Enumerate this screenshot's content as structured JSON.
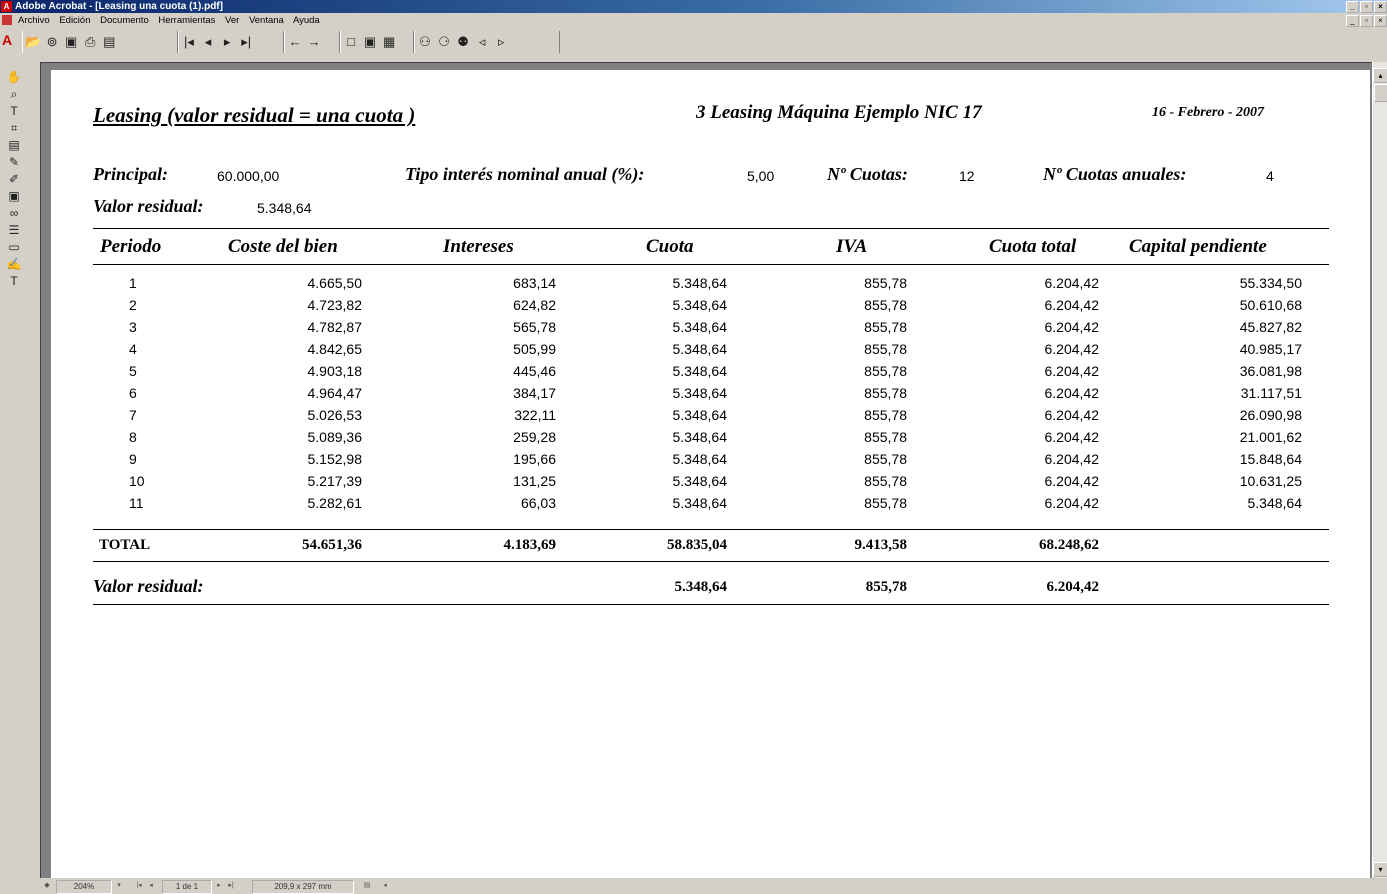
{
  "window": {
    "title": "Adobe Acrobat - [Leasing una cuota (1).pdf]",
    "min": "_",
    "max": "▫",
    "close": "×"
  },
  "menu": [
    "Archivo",
    "Edición",
    "Documento",
    "Herramientas",
    "Ver",
    "Ventana",
    "Ayuda"
  ],
  "status": {
    "zoom": "204%",
    "page": "1 de 1",
    "size": "209,9 x 297 mm"
  },
  "doc": {
    "title": "Leasing  (valor residual  = una cuota )",
    "subtitle": "3 Leasing Máquina Ejemplo NIC 17",
    "date": "16 - Febrero - 2007",
    "principal_label": "Principal:",
    "principal_value": "60.000,00",
    "rate_label": "Tipo interés nominal anual (%):",
    "rate_value": "5,00",
    "cuotas_label": "Nº Cuotas:",
    "cuotas_value": "12",
    "cuotas_anuales_label": "Nº Cuotas anuales:",
    "cuotas_anuales_value": "4",
    "residual_label": "Valor residual:",
    "residual_value": "5.348,64",
    "columns": [
      "Periodo",
      "Coste del bien",
      "Intereses",
      "Cuota",
      "IVA",
      "Cuota total",
      "Capital pendiente"
    ],
    "rows": [
      [
        "1",
        "4.665,50",
        "683,14",
        "5.348,64",
        "855,78",
        "6.204,42",
        "55.334,50"
      ],
      [
        "2",
        "4.723,82",
        "624,82",
        "5.348,64",
        "855,78",
        "6.204,42",
        "50.610,68"
      ],
      [
        "3",
        "4.782,87",
        "565,78",
        "5.348,64",
        "855,78",
        "6.204,42",
        "45.827,82"
      ],
      [
        "4",
        "4.842,65",
        "505,99",
        "5.348,64",
        "855,78",
        "6.204,42",
        "40.985,17"
      ],
      [
        "5",
        "4.903,18",
        "445,46",
        "5.348,64",
        "855,78",
        "6.204,42",
        "36.081,98"
      ],
      [
        "6",
        "4.964,47",
        "384,17",
        "5.348,64",
        "855,78",
        "6.204,42",
        "31.117,51"
      ],
      [
        "7",
        "5.026,53",
        "322,11",
        "5.348,64",
        "855,78",
        "6.204,42",
        "26.090,98"
      ],
      [
        "8",
        "5.089,36",
        "259,28",
        "5.348,64",
        "855,78",
        "6.204,42",
        "21.001,62"
      ],
      [
        "9",
        "5.152,98",
        "195,66",
        "5.348,64",
        "855,78",
        "6.204,42",
        "15.848,64"
      ],
      [
        "10",
        "5.217,39",
        "131,25",
        "5.348,64",
        "855,78",
        "6.204,42",
        "10.631,25"
      ],
      [
        "11",
        "5.282,61",
        "66,03",
        "5.348,64",
        "855,78",
        "6.204,42",
        "5.348,64"
      ]
    ],
    "total_label": "TOTAL",
    "totals": [
      "54.651,36",
      "4.183,69",
      "58.835,04",
      "9.413,58",
      "68.248,62"
    ],
    "residual_row_label": "Valor residual:",
    "residual_row": [
      "5.348,64",
      "855,78",
      "6.204,42"
    ]
  }
}
